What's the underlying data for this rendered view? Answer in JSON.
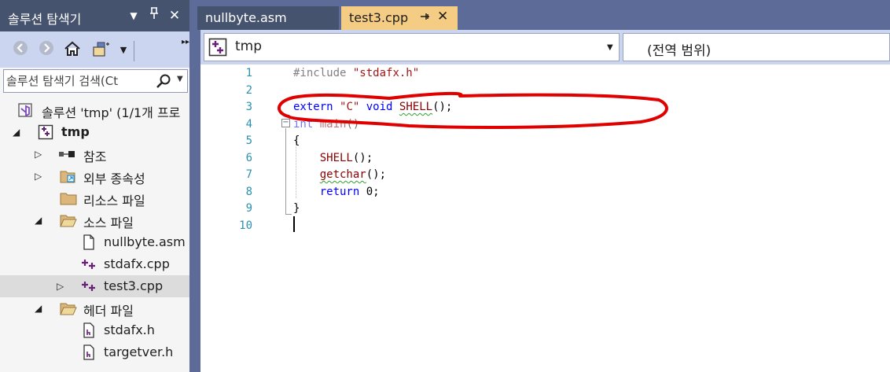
{
  "solution_explorer": {
    "title": "솔루션 탐색기",
    "search_placeholder": "솔루션 탐색기 검색(Ct",
    "tree": [
      {
        "label": "솔루션 'tmp' (1/1개 프로",
        "icon": "vs-solution-icon",
        "expanded": null
      },
      {
        "label": "tmp",
        "icon": "cpp-project-icon",
        "expanded": true,
        "bold": true
      },
      {
        "label": "참조",
        "icon": "references-icon",
        "expanded": false
      },
      {
        "label": "외부 종속성",
        "icon": "external-dependencies-icon",
        "expanded": false
      },
      {
        "label": "리소스 파일",
        "icon": "folder-icon",
        "expanded": null
      },
      {
        "label": "소스 파일",
        "icon": "folder-open-icon",
        "expanded": true
      },
      {
        "label": "nullbyte.asm",
        "icon": "file-icon",
        "expanded": null
      },
      {
        "label": "stdafx.cpp",
        "icon": "cpp-file-icon",
        "expanded": null
      },
      {
        "label": "test3.cpp",
        "icon": "cpp-file-icon",
        "expanded": false,
        "selected": true
      },
      {
        "label": "헤더 파일",
        "icon": "folder-open-icon",
        "expanded": true
      },
      {
        "label": "stdafx.h",
        "icon": "header-file-icon",
        "expanded": null
      },
      {
        "label": "targetver.h",
        "icon": "header-file-icon",
        "expanded": null
      }
    ]
  },
  "editor": {
    "tabs": [
      {
        "label": "nullbyte.asm",
        "active": false
      },
      {
        "label": "test3.cpp",
        "active": true
      }
    ],
    "nav_project": "tmp",
    "nav_scope": "(전역 범위)",
    "line_numbers": [
      "1",
      "2",
      "3",
      "4",
      "5",
      "6",
      "7",
      "8",
      "9",
      "10"
    ],
    "code": {
      "l1_pp": "#include",
      "l1_str": "\"stdafx.h\"",
      "l3_kw1": "extern",
      "l3_str": "\"C\"",
      "l3_kw2": "void",
      "l3_fn": "SHELL",
      "l3_end": "();",
      "l4_kw": "int",
      "l4_fn": "main",
      "l4_end": "()",
      "l5": "{",
      "l6_fn": "SHELL",
      "l6_end": "();",
      "l7_fn": "getchar",
      "l7_end": "();",
      "l8_kw": "return",
      "l8_end": "0;",
      "l9": "}"
    }
  },
  "colors": {
    "title_bar": "#46536e",
    "toolbar": "#ccd5f0",
    "active_tab": "#f5cc84",
    "annotation": "#e00000"
  }
}
